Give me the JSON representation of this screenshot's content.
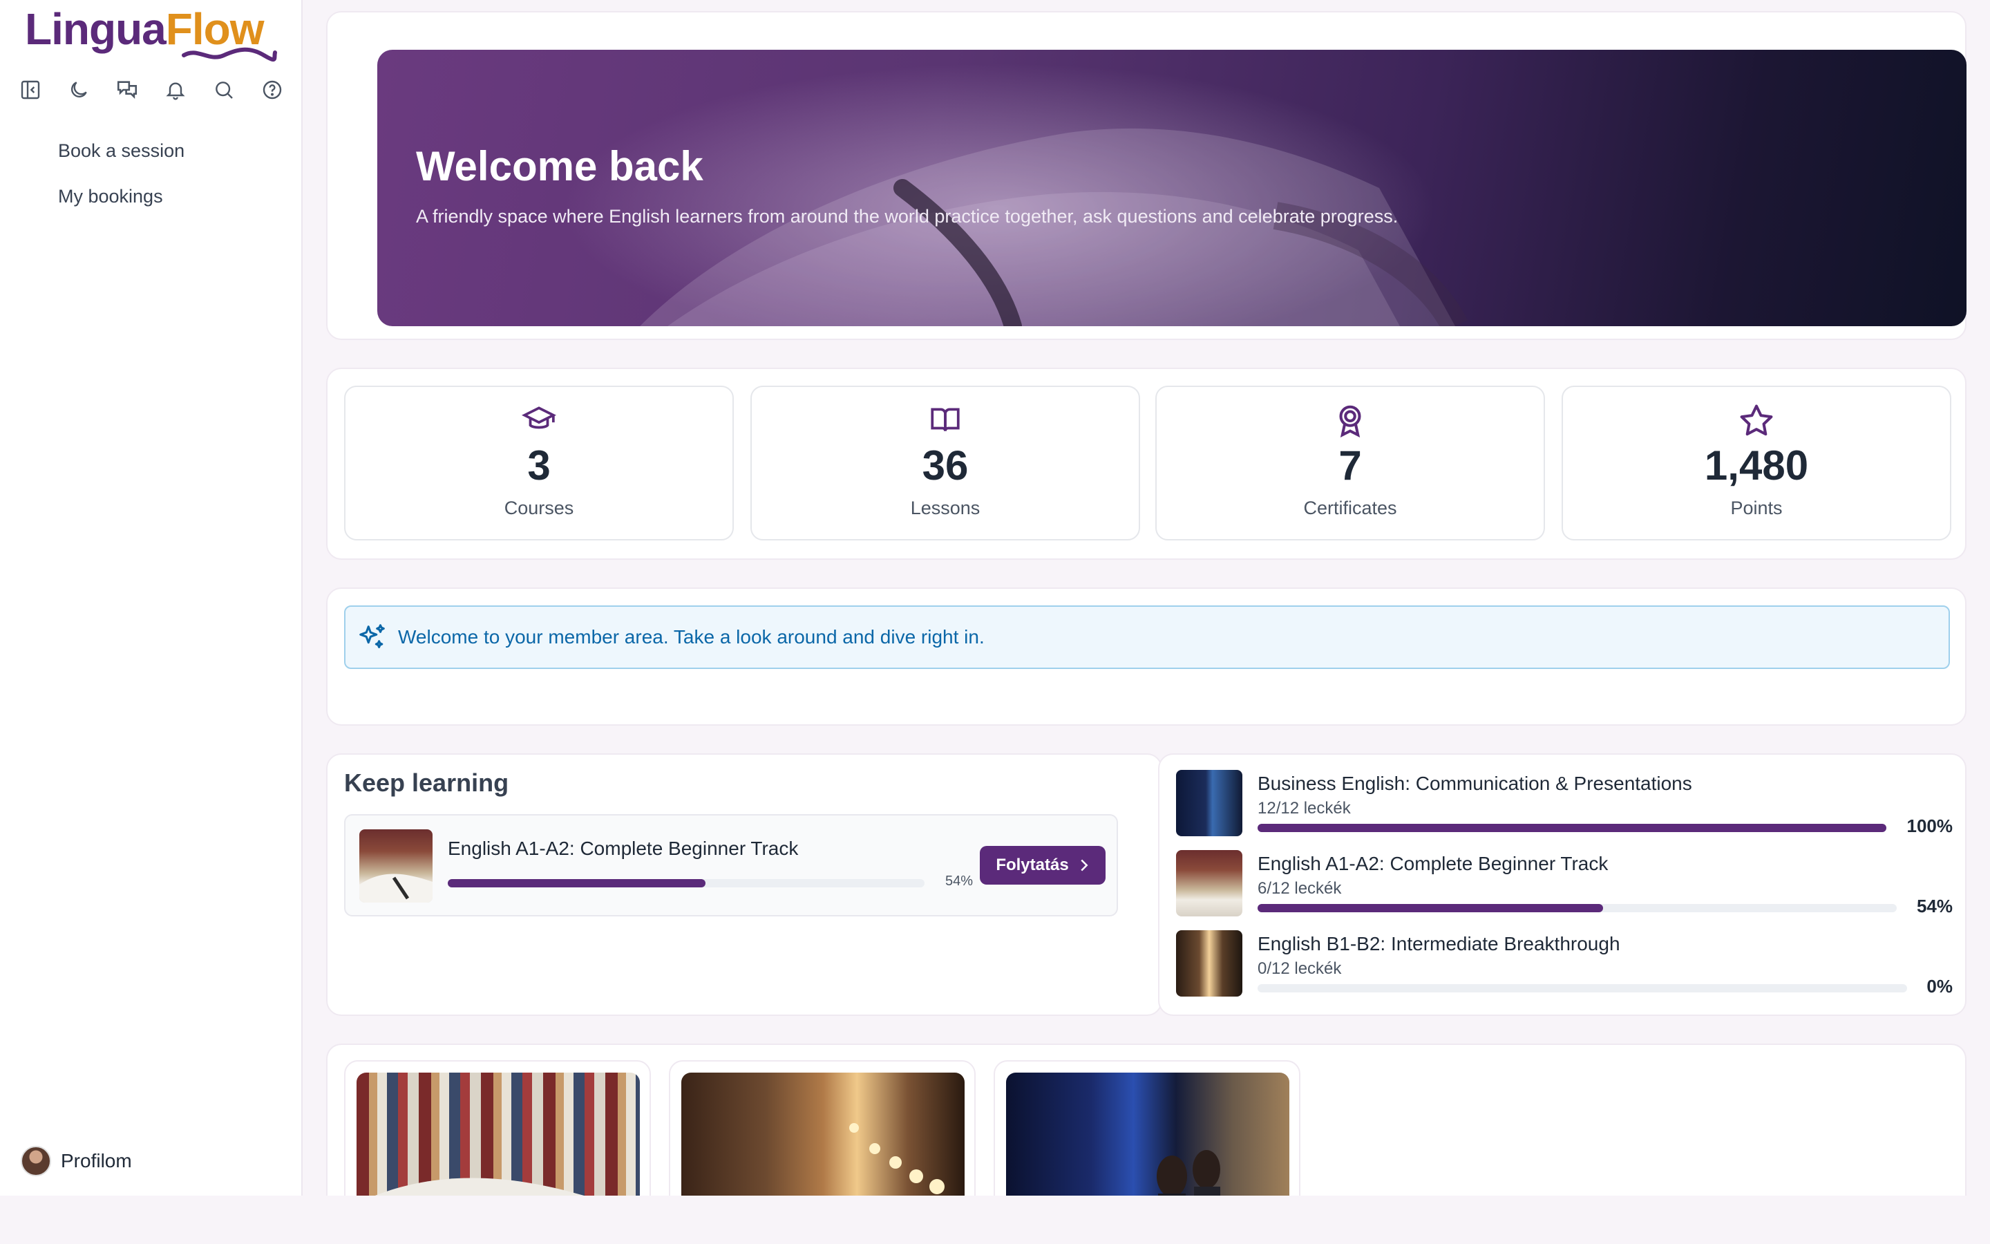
{
  "brand": {
    "part1": "Lingua",
    "part2": "Flow",
    "color_primary": "#5b2a7a",
    "color_accent": "#e0901c"
  },
  "toolbar": {
    "icons": [
      "collapse-sidebar-icon",
      "dark-mode-icon",
      "chat-icon",
      "notification-bell-icon",
      "search-icon",
      "help-icon"
    ]
  },
  "nav": {
    "items": [
      {
        "label": "Book a session"
      },
      {
        "label": "My bookings"
      }
    ]
  },
  "profile": {
    "label": "Profilom"
  },
  "hero": {
    "title": "Welcome back",
    "subtitle": "A friendly space where English learners from around the world practice together, ask questions and celebrate progress."
  },
  "stats": [
    {
      "value": "3",
      "label": "Courses",
      "icon": "graduation-cap-icon"
    },
    {
      "value": "36",
      "label": "Lessons",
      "icon": "open-book-icon"
    },
    {
      "value": "7",
      "label": "Certificates",
      "icon": "award-ribbon-icon"
    },
    {
      "value": "1,480",
      "label": "Points",
      "icon": "star-icon"
    }
  ],
  "notice": {
    "text": "Welcome to your member area. Take a look around and dive right in.",
    "icon": "sparkles-icon"
  },
  "keep_learning": {
    "title": "Keep learning",
    "course": {
      "name": "English A1-A2: Complete Beginner Track",
      "progress": 54,
      "progress_label": "54%",
      "button_label": "Folytatás"
    }
  },
  "courses": [
    {
      "name": "Business English: Communication & Presentations",
      "lessons": "12/12 leckék",
      "progress": 100,
      "progress_label": "100%"
    },
    {
      "name": "English A1-A2: Complete Beginner Track",
      "lessons": "6/12 leckék",
      "progress": 54,
      "progress_label": "54%"
    },
    {
      "name": "English B1-B2: Intermediate Breakthrough",
      "lessons": "0/12 leckék",
      "progress": 0,
      "progress_label": "0%"
    }
  ]
}
